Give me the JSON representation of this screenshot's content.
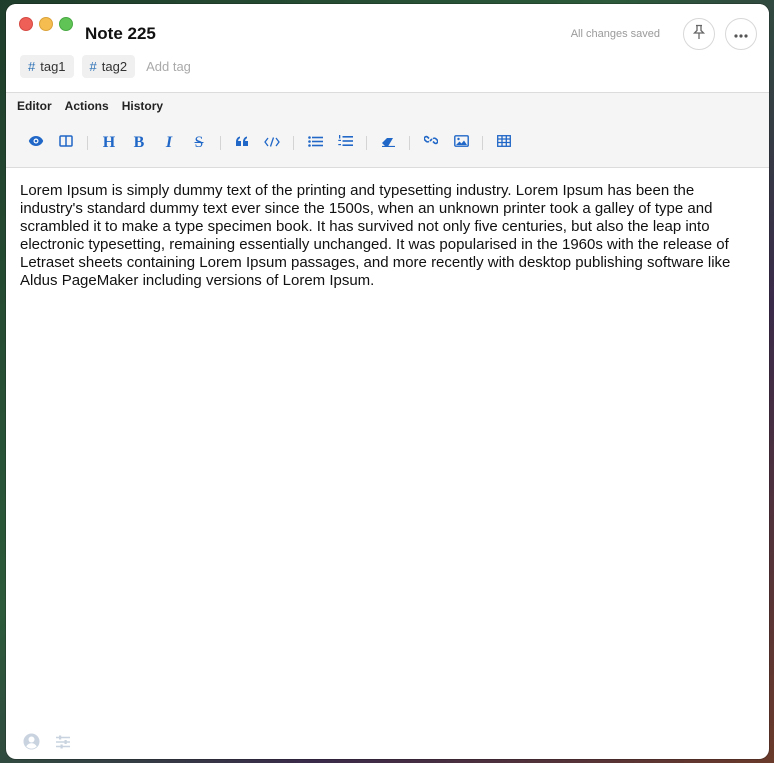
{
  "window": {
    "title": "Note 225",
    "status": "All changes saved"
  },
  "tags": {
    "items": [
      {
        "label": "tag1"
      },
      {
        "label": "tag2"
      }
    ],
    "add_placeholder": "Add tag"
  },
  "menubar": {
    "items": [
      "Editor",
      "Actions",
      "History"
    ]
  },
  "toolbar": {
    "buttons": [
      {
        "icon": "eye-icon"
      },
      {
        "icon": "split-view-icon"
      },
      {
        "icon": "heading-icon",
        "text": "H"
      },
      {
        "icon": "bold-icon",
        "text": "B"
      },
      {
        "icon": "italic-icon",
        "text": "I"
      },
      {
        "icon": "strikethrough-icon",
        "text": "S"
      },
      {
        "icon": "quote-icon"
      },
      {
        "icon": "code-icon"
      },
      {
        "icon": "bullet-list-icon"
      },
      {
        "icon": "numbered-list-icon"
      },
      {
        "icon": "eraser-icon"
      },
      {
        "icon": "link-icon"
      },
      {
        "icon": "image-icon"
      },
      {
        "icon": "table-icon"
      }
    ]
  },
  "content": {
    "body": "Lorem Ipsum is simply dummy text of the printing and typesetting industry. Lorem Ipsum has been the industry's standard dummy text ever since the 1500s, when an unknown printer took a galley of type and scrambled it to make a type specimen book. It has survived not only five centuries, but also the leap into electronic typesetting, remaining essentially unchanged. It was popularised in the 1960s with the release of Letraset sheets containing Lorem Ipsum passages, and more recently with desktop publishing software like Aldus PageMaker including versions of Lorem Ipsum."
  },
  "footer": {
    "icons": [
      "account-icon",
      "settings-sliders-icon"
    ]
  },
  "colors": {
    "accent": "#2067c7",
    "close": "#ed5f57",
    "minimize": "#f5bd4f",
    "maximize": "#5fc455"
  }
}
